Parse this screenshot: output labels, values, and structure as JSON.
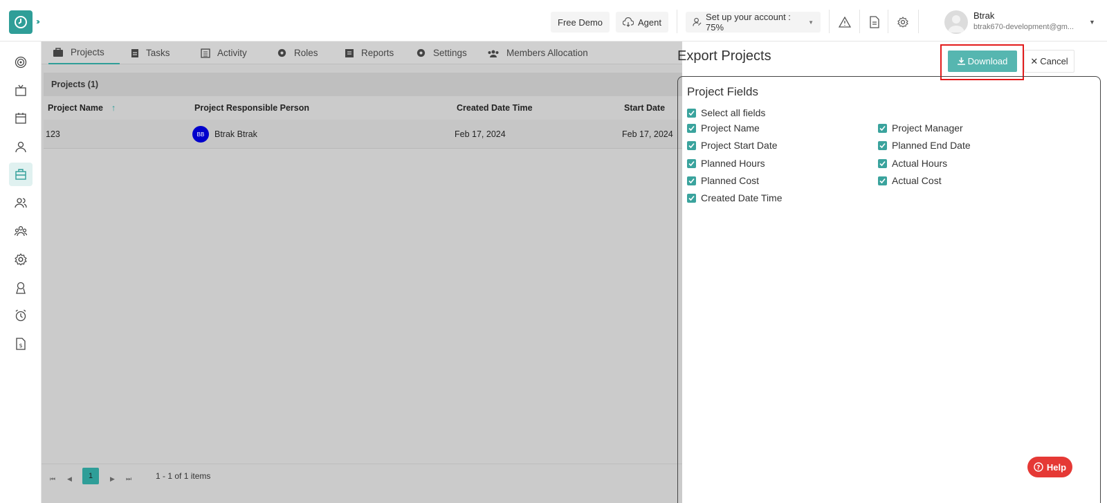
{
  "topbar": {
    "free_demo": "Free Demo",
    "agent": "Agent",
    "setup": "Set up your account : 75%",
    "user_name": "Btrak",
    "user_email": "btrak670-development@gm..."
  },
  "tabs": [
    "Projects",
    "Tasks",
    "Activity",
    "Roles",
    "Reports",
    "Settings",
    "Members Allocation"
  ],
  "projects": {
    "header": "Projects  (1)",
    "columns": [
      "Project Name",
      "Project Responsible Person",
      "Created Date Time",
      "Start Date"
    ],
    "rows": [
      {
        "name": "123",
        "initials": "BB",
        "person": "Btrak Btrak",
        "created": "Feb 17, 2024",
        "start": "Feb 17, 2024"
      }
    ]
  },
  "pager": {
    "page": "1",
    "summary": "1 - 1 of 1 items"
  },
  "export": {
    "title": "Export Projects",
    "download": "Download",
    "cancel": "Cancel",
    "fields_title": "Project Fields",
    "select_all": "Select all fields",
    "fields_left": [
      "Project Name",
      "Project Start Date",
      "Planned Hours",
      "Planned Cost",
      "Created Date Time"
    ],
    "fields_right": [
      "Project Manager",
      "Planned End Date",
      "Actual Hours",
      "Actual Cost"
    ]
  },
  "help": "Help",
  "colors": {
    "accent": "#2f9e98",
    "download": "#56b6b0",
    "highlight": "#e21b1b",
    "help": "#e53935"
  }
}
